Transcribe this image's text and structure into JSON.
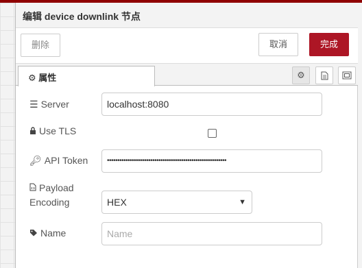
{
  "dialog": {
    "title": "编辑 device downlink 节点",
    "delete_label": "删除",
    "cancel_label": "取消",
    "done_label": "完成"
  },
  "tabs": {
    "properties_label": "属性"
  },
  "fields": {
    "server": {
      "label": "Server",
      "value": "localhost:8080"
    },
    "use_tls": {
      "label": "Use TLS",
      "checked": false
    },
    "api_token": {
      "label": "API Token",
      "value": "••••••••••••••••••••••••••••••••••••••••••••••••••••••••••"
    },
    "payload_encoding": {
      "label_line1": "Payload",
      "label_line2": "Encoding",
      "value": "HEX"
    },
    "name": {
      "label": "Name",
      "placeholder": "Name"
    }
  },
  "icons": {
    "settings_tab": "gear-icon",
    "description_tab": "document-icon",
    "appearance_tab": "frame-icon",
    "server_field": "server-icon",
    "tls_field": "lock-icon",
    "token_field": "key-icon",
    "encoding_field": "code-file-icon",
    "name_field": "tag-icon"
  },
  "colors": {
    "done_button": "#ad1625",
    "top_strip": "#8f0000"
  }
}
